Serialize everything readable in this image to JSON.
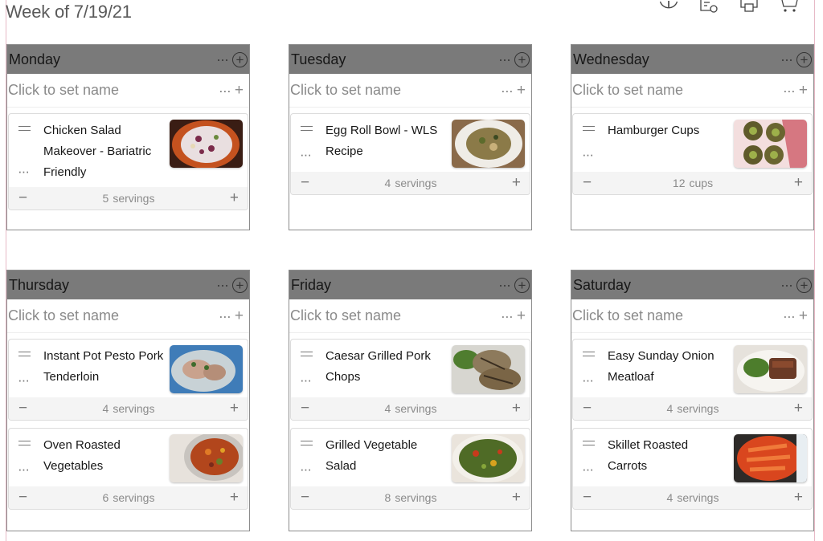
{
  "page": {
    "title": "Week of 7/19/21",
    "border_color": "#e7b9c6",
    "day_header_color": "#7a7a7a"
  },
  "toolbar": [
    {
      "icon": "info-icon"
    },
    {
      "icon": "list-icon"
    },
    {
      "icon": "print-icon"
    },
    {
      "icon": "cart-icon"
    }
  ],
  "days": [
    {
      "name": "Monday",
      "meal_name_placeholder": "Click to set name",
      "recipes": [
        {
          "title": "Chicken Salad Makeover - Bariatric Friendly",
          "servings": "5",
          "unit": "servings",
          "image": "chicken-salad-photo"
        }
      ]
    },
    {
      "name": "Tuesday",
      "meal_name_placeholder": "Click to set name",
      "recipes": [
        {
          "title": "Egg Roll Bowl - WLS Recipe",
          "servings": "4",
          "unit": "servings",
          "image": "egg-roll-bowl-photo"
        }
      ]
    },
    {
      "name": "Wednesday",
      "meal_name_placeholder": "Click to set name",
      "recipes": [
        {
          "title": "Hamburger Cups",
          "servings": "12",
          "unit": "cups",
          "image": "hamburger-cups-photo"
        }
      ]
    },
    {
      "name": "Thursday",
      "meal_name_placeholder": "Click to set name",
      "recipes": [
        {
          "title": "Instant Pot Pesto Pork Tenderloin",
          "servings": "4",
          "unit": "servings",
          "image": "pesto-pork-photo"
        },
        {
          "title": "Oven Roasted Vegetables",
          "servings": "6",
          "unit": "servings",
          "image": "roasted-vegetables-photo"
        }
      ]
    },
    {
      "name": "Friday",
      "meal_name_placeholder": "Click to set name",
      "recipes": [
        {
          "title": "Caesar Grilled Pork Chops",
          "servings": "4",
          "unit": "servings",
          "image": "pork-chops-photo"
        },
        {
          "title": "Grilled Vegetable Salad",
          "servings": "8",
          "unit": "servings",
          "image": "vegetable-salad-photo"
        }
      ]
    },
    {
      "name": "Saturday",
      "meal_name_placeholder": "Click to set name",
      "recipes": [
        {
          "title": "Easy Sunday Onion Meatloaf",
          "servings": "4",
          "unit": "servings",
          "image": "meatloaf-photo"
        },
        {
          "title": "Skillet Roasted Carrots",
          "servings": "4",
          "unit": "servings",
          "image": "carrots-photo"
        }
      ]
    }
  ]
}
